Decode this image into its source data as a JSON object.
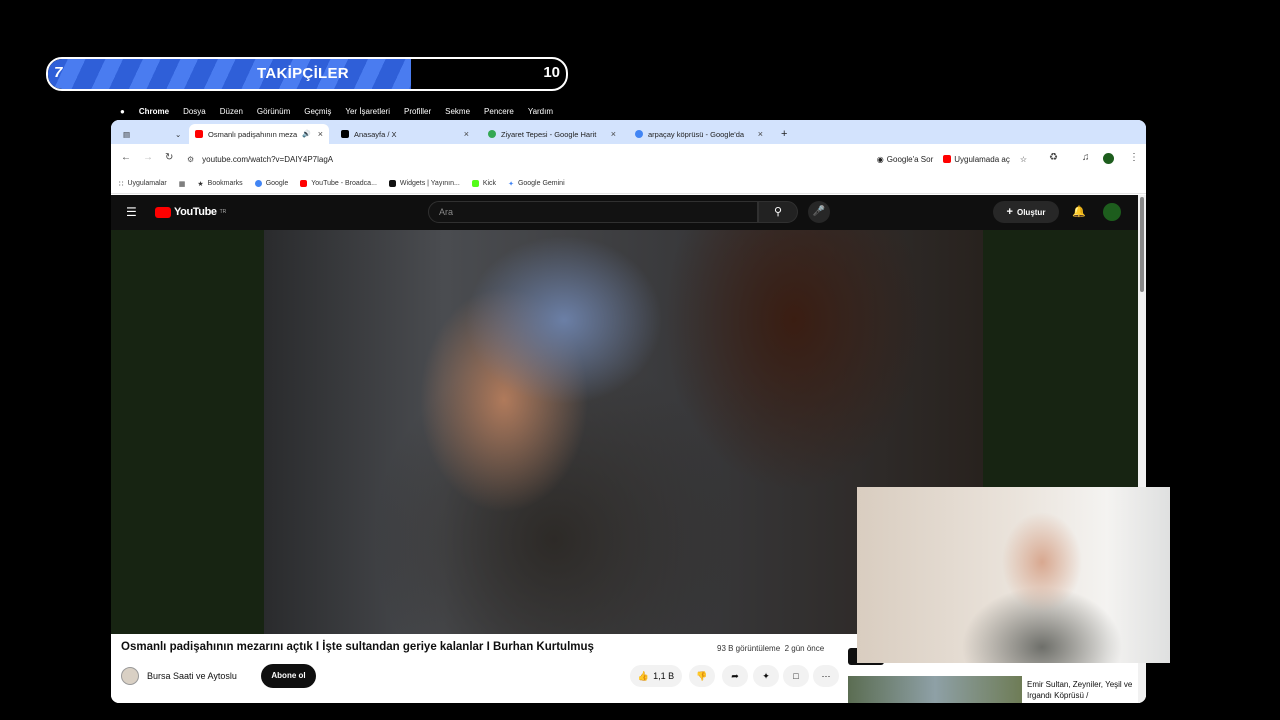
{
  "followers": {
    "label": "TAKİPÇİLER",
    "start": "7",
    "end": "10",
    "progress": 0.7
  },
  "macmenu": {
    "apple": "",
    "app": "Chrome",
    "items": [
      "Dosya",
      "Düzen",
      "Görünüm",
      "Geçmiş",
      "Yer İşaretleri",
      "Profiller",
      "Sekme",
      "Pencere",
      "Yardım"
    ]
  },
  "tabs": [
    {
      "title": "Osmanlı padişahının meza",
      "favicon": "youtube-icon",
      "active": true
    },
    {
      "title": "Anasayfa / X",
      "favicon": "x-icon",
      "active": false
    },
    {
      "title": "Ziyaret Tepesi - Google Harit",
      "favicon": "maps-icon",
      "active": false
    },
    {
      "title": "arpaçay köprüsü - Google'da",
      "favicon": "google-icon",
      "active": false
    }
  ],
  "address": {
    "url": "youtube.com/watch?v=DAIY4P7lagA",
    "ask_google": "Google'a Sor",
    "open_in_app": "Uygulamada aç"
  },
  "bookmarks": [
    "Uygulamalar",
    "Bookmarks",
    "Google",
    "YouTube - Broadca...",
    "Widgets | Yayının...",
    "Kick",
    "Google Gemini"
  ],
  "youtube": {
    "logo": "YouTube",
    "region": "TR",
    "search_placeholder": "Ara",
    "create_label": "Oluştur",
    "video_title": "Osmanlı padişahının mezarını açtık I İşte sultandan geriye kalanlar I Burhan Kurtulmuş",
    "views": "93 B görüntüleme",
    "age": "2 gün önce",
    "channel": "Bursa Saati ve Aytoslu",
    "subscribe": "Abone ol",
    "likes": "1,1 B",
    "recommendation": "Emir Sultan, Zeyniler, Yeşil ve Irgandı Köprüsü /"
  }
}
